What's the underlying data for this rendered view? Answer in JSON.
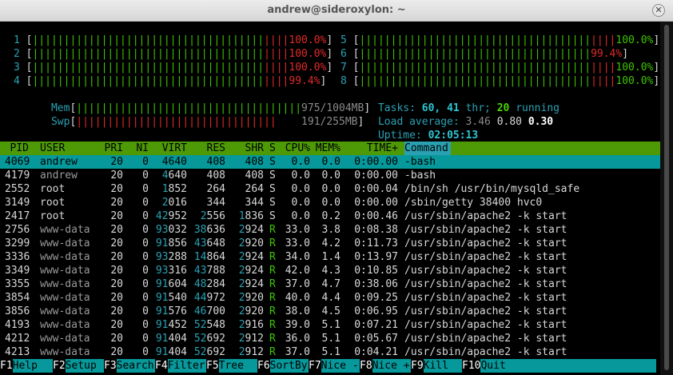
{
  "window": {
    "title": "andrew@sideroxylon: ~"
  },
  "meters": {
    "cpus": [
      {
        "label": "1",
        "bar": "[||||||||||||||||||||||||||||||||||||",
        "pct": "100.0%"
      },
      {
        "label": "2",
        "bar": "[||||||||||||||||||||||||||||||||||||",
        "pct": "100.0%"
      },
      {
        "label": "3",
        "bar": "[||||||||||||||||||||||||||||||||||||",
        "pct": "100.0%"
      },
      {
        "label": "4",
        "bar": "[||||||||||||||||||||||||||||||||||||",
        "pct": "99.4%"
      },
      {
        "label": "5",
        "bar": "[||||||||||||||||||||||||||||||||||||",
        "pct": "100.0%"
      },
      {
        "label": "6",
        "bar": "[||||||||||||||||||||||||||||||||||||",
        "pct": "99.4%"
      },
      {
        "label": "7",
        "bar": "[||||||||||||||||||||||||||||||||||||",
        "pct": "100.0%"
      },
      {
        "label": "8",
        "bar": "[||||||||||||||||||||||||||||||||||||",
        "pct": "100.0%"
      }
    ],
    "mem": {
      "label": "Mem",
      "value": "975/1004MB"
    },
    "swp": {
      "label": "Swp",
      "value": "191/255MB"
    },
    "tasks": {
      "label": "Tasks:",
      "count": "60,",
      "threads": "41",
      "thr_label": "thr;",
      "running": "20",
      "running_label": "running"
    },
    "load": {
      "label": "Load average:",
      "l1": "3.46",
      "l5": "0.80",
      "l15": "0.30"
    },
    "uptime": {
      "label": "Uptime:",
      "value": "02:05:13"
    }
  },
  "columns": [
    "PID",
    "USER",
    "PRI",
    "NI",
    "VIRT",
    "RES",
    "SHR",
    "S",
    "CPU%",
    "MEM%",
    "TIME+",
    "Command"
  ],
  "processes": [
    {
      "pid": "4069",
      "user": "andrew",
      "pri": "20",
      "ni": "0",
      "virt": "4640",
      "res": "408",
      "shr": "408",
      "s": "S",
      "cpu": "0.0",
      "mem": "0.0",
      "time": "0:00.00",
      "cmd": "-bash"
    },
    {
      "pid": "4179",
      "user": "andrew",
      "pri": "20",
      "ni": "0",
      "virt": "4640",
      "res": "408",
      "shr": "408",
      "s": "S",
      "cpu": "0.0",
      "mem": "0.0",
      "time": "0:00.00",
      "cmd": "-bash"
    },
    {
      "pid": "2552",
      "user": "root",
      "pri": "20",
      "ni": "0",
      "virt": "1852",
      "res": "264",
      "shr": "264",
      "s": "S",
      "cpu": "0.0",
      "mem": "0.0",
      "time": "0:00.04",
      "cmd": "/bin/sh /usr/bin/mysqld_safe"
    },
    {
      "pid": "3149",
      "user": "root",
      "pri": "20",
      "ni": "0",
      "virt": "2016",
      "res": "344",
      "shr": "344",
      "s": "S",
      "cpu": "0.0",
      "mem": "0.0",
      "time": "0:00.00",
      "cmd": "/sbin/getty 38400 hvc0"
    },
    {
      "pid": "2417",
      "user": "root",
      "pri": "20",
      "ni": "0",
      "virt": "42952",
      "res": "2556",
      "shr": "1836",
      "s": "S",
      "cpu": "0.0",
      "mem": "0.2",
      "time": "0:00.46",
      "cmd": "/usr/sbin/apache2 -k start"
    },
    {
      "pid": "2756",
      "user": "www-data",
      "pri": "20",
      "ni": "0",
      "virt": "93032",
      "res": "38636",
      "shr": "2924",
      "s": "R",
      "cpu": "33.0",
      "mem": "3.8",
      "time": "0:08.38",
      "cmd": "/usr/sbin/apache2 -k start"
    },
    {
      "pid": "3299",
      "user": "www-data",
      "pri": "20",
      "ni": "0",
      "virt": "91856",
      "res": "43648",
      "shr": "2920",
      "s": "R",
      "cpu": "33.0",
      "mem": "4.2",
      "time": "0:11.73",
      "cmd": "/usr/sbin/apache2 -k start"
    },
    {
      "pid": "3336",
      "user": "www-data",
      "pri": "20",
      "ni": "0",
      "virt": "93288",
      "res": "14864",
      "shr": "2924",
      "s": "R",
      "cpu": "34.0",
      "mem": "1.4",
      "time": "0:13.97",
      "cmd": "/usr/sbin/apache2 -k start"
    },
    {
      "pid": "3349",
      "user": "www-data",
      "pri": "20",
      "ni": "0",
      "virt": "93316",
      "res": "43788",
      "shr": "2924",
      "s": "R",
      "cpu": "42.0",
      "mem": "4.3",
      "time": "0:10.85",
      "cmd": "/usr/sbin/apache2 -k start"
    },
    {
      "pid": "3355",
      "user": "www-data",
      "pri": "20",
      "ni": "0",
      "virt": "91604",
      "res": "48284",
      "shr": "2924",
      "s": "R",
      "cpu": "37.0",
      "mem": "4.7",
      "time": "0:38.06",
      "cmd": "/usr/sbin/apache2 -k start"
    },
    {
      "pid": "3854",
      "user": "www-data",
      "pri": "20",
      "ni": "0",
      "virt": "91540",
      "res": "44972",
      "shr": "2920",
      "s": "R",
      "cpu": "40.0",
      "mem": "4.4",
      "time": "0:09.25",
      "cmd": "/usr/sbin/apache2 -k start"
    },
    {
      "pid": "3856",
      "user": "www-data",
      "pri": "20",
      "ni": "0",
      "virt": "91576",
      "res": "46700",
      "shr": "2920",
      "s": "R",
      "cpu": "38.0",
      "mem": "4.5",
      "time": "0:06.95",
      "cmd": "/usr/sbin/apache2 -k start"
    },
    {
      "pid": "4193",
      "user": "www-data",
      "pri": "20",
      "ni": "0",
      "virt": "91452",
      "res": "52548",
      "shr": "2916",
      "s": "R",
      "cpu": "39.0",
      "mem": "5.1",
      "time": "0:07.21",
      "cmd": "/usr/sbin/apache2 -k start"
    },
    {
      "pid": "4212",
      "user": "www-data",
      "pri": "20",
      "ni": "0",
      "virt": "91404",
      "res": "52692",
      "shr": "2912",
      "s": "R",
      "cpu": "36.0",
      "mem": "5.1",
      "time": "0:05.67",
      "cmd": "/usr/sbin/apache2 -k start"
    },
    {
      "pid": "4213",
      "user": "www-data",
      "pri": "20",
      "ni": "0",
      "virt": "91404",
      "res": "52692",
      "shr": "2912",
      "s": "R",
      "cpu": "37.0",
      "mem": "5.1",
      "time": "0:04.21",
      "cmd": "/usr/sbin/apache2 -k start"
    }
  ],
  "footer": [
    {
      "key": "F1",
      "label": "Help"
    },
    {
      "key": "F2",
      "label": "Setup"
    },
    {
      "key": "F3",
      "label": "Search"
    },
    {
      "key": "F4",
      "label": "Filter"
    },
    {
      "key": "F5",
      "label": "Tree"
    },
    {
      "key": "F6",
      "label": "SortBy"
    },
    {
      "key": "F7",
      "label": "Nice -"
    },
    {
      "key": "F8",
      "label": "Nice +"
    },
    {
      "key": "F9",
      "label": "Kill"
    },
    {
      "key": "F10",
      "label": "Quit"
    }
  ],
  "colors": {
    "header_bg": "#4e9a06",
    "selected_bg": "#06989a",
    "bar_green": "#3ec400",
    "bar_red": "#e22a2a"
  }
}
